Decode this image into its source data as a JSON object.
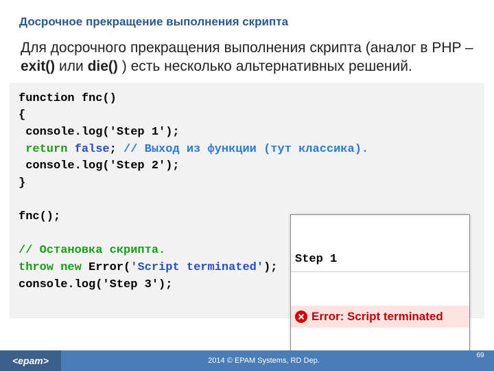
{
  "title": "Досрочное прекращение выполнения скрипта",
  "body_pre": "Для досрочного прекращения выполнения скрипта (аналог в PHP – ",
  "body_b1": "exit()",
  "body_mid": " или ",
  "body_b2": "die()",
  "body_post": " ) есть несколько альтернативных решений.",
  "code": {
    "l1": "function fnc()",
    "l2": "{",
    "l3": " console.log('Step 1');",
    "l4a": " ",
    "l4_kw": "return ",
    "l4_false": "false",
    "l4_semi": "; ",
    "l4_comment": "// Выход из функции (тут классика).",
    "l5": " console.log('Step 2');",
    "l6": "}",
    "l7": "",
    "l8": "fnc();",
    "l9": "",
    "l10_comment": "// Остановка скрипта.",
    "l11_kw": "throw new ",
    "l11_err": "Error",
    "l11_p": "(",
    "l11_str": "'Script terminated'",
    "l11_close": ");",
    "l12": "console.log('Step 3');"
  },
  "console": {
    "step": "Step 1",
    "err": "Error: Script terminated"
  },
  "footer": {
    "logo": "<epam>",
    "copyright": "2014 © EPAM Systems, RD Dep.",
    "page": "69"
  }
}
